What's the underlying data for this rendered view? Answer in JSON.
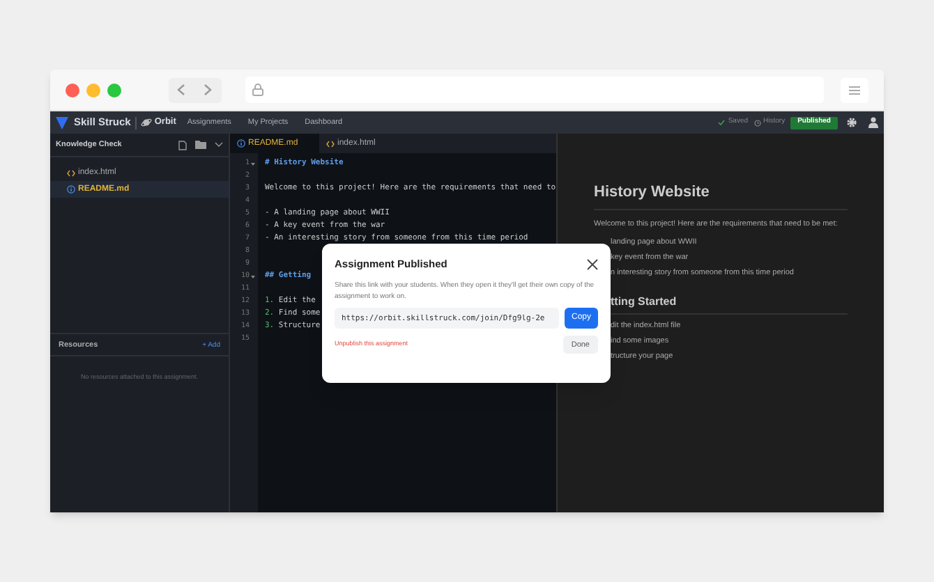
{
  "app": {
    "brand": "Skill Struck",
    "product": "Orbit",
    "nav": [
      "Assignments",
      "My Projects",
      "Dashboard"
    ],
    "saved": "Saved",
    "history": "History",
    "publish_button": "Published"
  },
  "sidebar": {
    "title": "Knowledge Check",
    "files": [
      {
        "name": "index.html",
        "kind": "html",
        "selected": false
      },
      {
        "name": "README.md",
        "kind": "info",
        "selected": true
      }
    ],
    "resources": {
      "title": "Resources",
      "add": "+ Add",
      "empty": "No resources attached to this assignment."
    }
  },
  "editor": {
    "tabs": [
      {
        "label": "README.md",
        "kind": "info",
        "selected": true
      },
      {
        "label": "index.html",
        "kind": "html",
        "selected": false
      }
    ],
    "lines": [
      {
        "num": "1",
        "kind": "heading",
        "text": "# History Website",
        "fold": true
      },
      {
        "num": "2",
        "kind": "text"
      },
      {
        "num": "3",
        "kind": "text",
        "text": "Welcome to this project! Here are the requirements that need to"
      },
      {
        "num": "4",
        "kind": "text"
      },
      {
        "num": "5",
        "kind": "text",
        "text": "- A landing page about WWII"
      },
      {
        "num": "6",
        "kind": "text",
        "text": "- A key event from the war"
      },
      {
        "num": "7",
        "kind": "text",
        "text": "- An interesting story from someone from this time period"
      },
      {
        "num": "8",
        "kind": "text"
      },
      {
        "num": "9",
        "kind": "text"
      },
      {
        "num": "10",
        "kind": "heading",
        "text": "## Getting",
        "fold": true
      },
      {
        "num": "11",
        "kind": "text"
      },
      {
        "num": "12",
        "kind": "list",
        "marker": "1.",
        "text": "Edit the"
      },
      {
        "num": "13",
        "kind": "list",
        "marker": "2.",
        "text": "Find some"
      },
      {
        "num": "14",
        "kind": "list",
        "marker": "3.",
        "text": "Structure"
      },
      {
        "num": "15",
        "kind": "text"
      }
    ]
  },
  "preview": {
    "title": "History Website",
    "intro": "Welcome to this project! Here are the requirements that need to be met:",
    "items": [
      "landing page about WWII",
      "key event from the war",
      "n interesting story from someone from this time period"
    ],
    "subtitle": "tting Started",
    "steps": [
      "dit the index.html file",
      "ind some images",
      "tructure your page"
    ]
  },
  "dialog": {
    "title": "Assignment Published",
    "message": "Share this link with your students. When they open it they'll get their own copy of the assignment to work on.",
    "link": "https://orbit.skillstruck.com/join/Dfg9lg-2e",
    "copy_button": "Copy",
    "unpublish_link": "Unpublish this assignment",
    "done_button": "Done"
  }
}
